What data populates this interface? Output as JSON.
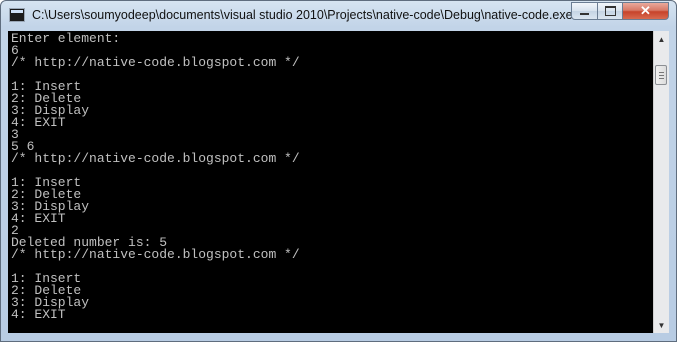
{
  "window": {
    "title": "C:\\Users\\soumyodeep\\documents\\visual studio 2010\\Projects\\native-code\\Debug\\native-code.exe"
  },
  "controls": {
    "close_label": "✕"
  },
  "console": {
    "lines": [
      "Enter element:",
      "6",
      "/* http://native-code.blogspot.com */",
      "",
      "1: Insert",
      "2: Delete",
      "3: Display",
      "4: EXIT",
      "3",
      "5 6",
      "/* http://native-code.blogspot.com */",
      "",
      "1: Insert",
      "2: Delete",
      "3: Display",
      "4: EXIT",
      "2",
      "Deleted number is: 5",
      "/* http://native-code.blogspot.com */",
      "",
      "1: Insert",
      "2: Delete",
      "3: Display",
      "4: EXIT"
    ]
  },
  "scrollbar": {
    "up_arrow": "▲",
    "down_arrow": "▼"
  },
  "colors": {
    "console_bg": "#000000",
    "console_text": "#c0c0c0",
    "close_red": "#c7432b"
  }
}
